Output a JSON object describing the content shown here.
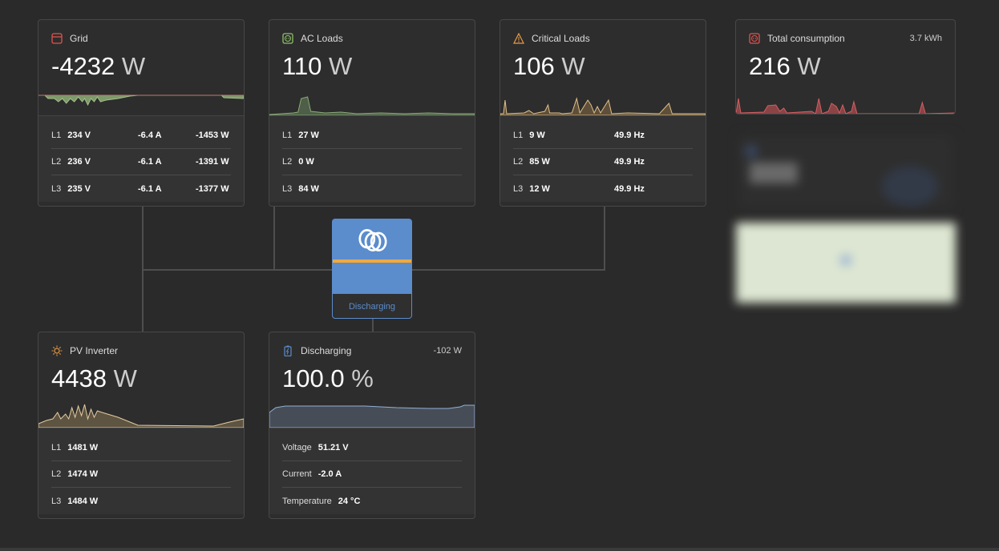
{
  "grid": {
    "title": "Grid",
    "value": "-4232",
    "unit": "W",
    "icon": "grid-meter-icon",
    "color": "#e0554f",
    "phases": [
      {
        "l": "L1",
        "v": "234 V",
        "a": "-6.4 A",
        "w": "-1453 W"
      },
      {
        "l": "L2",
        "v": "236 V",
        "a": "-6.1 A",
        "w": "-1391 W"
      },
      {
        "l": "L3",
        "v": "235 V",
        "a": "-6.1 A",
        "w": "-1377 W"
      }
    ]
  },
  "ac_loads": {
    "title": "AC Loads",
    "value": "110",
    "unit": "W",
    "icon": "socket-icon",
    "color": "#8ec26a",
    "phases": [
      {
        "l": "L1",
        "w": "27 W"
      },
      {
        "l": "L2",
        "w": "0 W"
      },
      {
        "l": "L3",
        "w": "84 W"
      }
    ]
  },
  "critical_loads": {
    "title": "Critical Loads",
    "value": "106",
    "unit": "W",
    "icon": "warning-icon",
    "color": "#e79a45",
    "phases": [
      {
        "l": "L1",
        "w": "9 W",
        "hz": "49.9 Hz"
      },
      {
        "l": "L2",
        "w": "85 W",
        "hz": "49.9 Hz"
      },
      {
        "l": "L3",
        "w": "12 W",
        "hz": "49.9 Hz"
      }
    ]
  },
  "total_consumption": {
    "title": "Total consumption",
    "value": "216",
    "unit": "W",
    "energy": "3.7 kWh",
    "icon": "socket-icon",
    "color": "#e0554f"
  },
  "inverter": {
    "status": "Discharging",
    "icon": "victron-logo-icon",
    "color": "#5b8ccc",
    "accent": "#f3a93a"
  },
  "pv_inverter": {
    "title": "PV Inverter",
    "value": "4438",
    "unit": "W",
    "icon": "sun-icon",
    "color": "#e79a45",
    "phases": [
      {
        "l": "L1",
        "w": "1481 W"
      },
      {
        "l": "L2",
        "w": "1474 W"
      },
      {
        "l": "L3",
        "w": "1484 W"
      }
    ]
  },
  "battery": {
    "title": "Discharging",
    "value": "100.0",
    "unit": "%",
    "power": "-102 W",
    "icon": "battery-icon",
    "color": "#5b8ccc",
    "details": [
      {
        "l": "Voltage",
        "v": "51.21 V"
      },
      {
        "l": "Current",
        "v": "-2.0 A"
      },
      {
        "l": "Temperature",
        "v": "24 °C"
      }
    ]
  }
}
